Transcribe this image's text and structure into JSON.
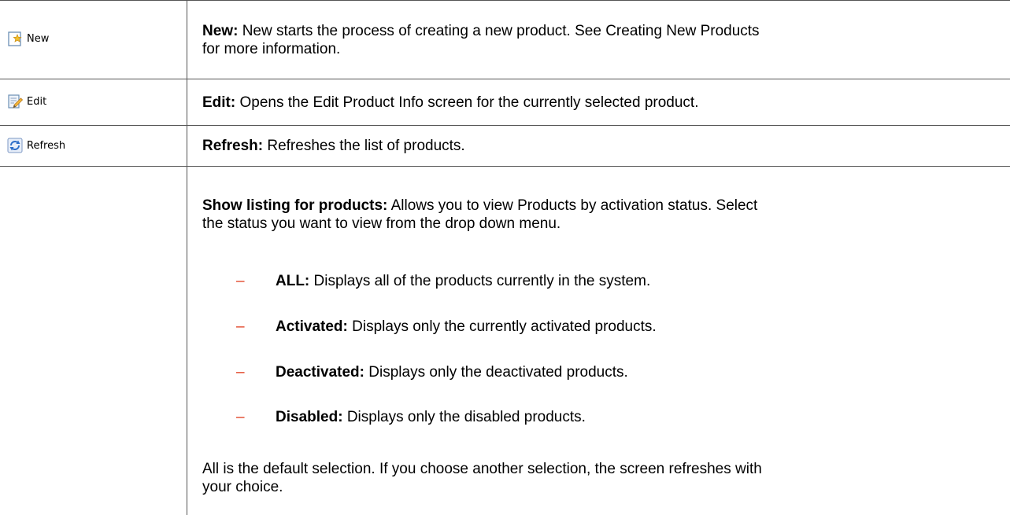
{
  "toolbar": {
    "new_label": "New",
    "edit_label": "Edit",
    "refresh_label": "Refresh"
  },
  "rows": {
    "new": {
      "term": "New:",
      "text": "New starts the process of creating a new product. See Creating New Products",
      "text2": "for more information."
    },
    "edit": {
      "term": "Edit:",
      "text": "Opens the Edit Product Info screen for the currently selected product."
    },
    "refresh": {
      "term": "Refresh:",
      "text": "Refreshes the list of products."
    },
    "listing": {
      "term": "Show listing for products:",
      "text": "Allows you to view Products by activation status. Select",
      "text2": "the status you want to view from the drop down menu.",
      "options": [
        {
          "term": "ALL:",
          "text": "Displays all of the products currently in the system."
        },
        {
          "term": "Activated:",
          "text": "Displays only the currently activated products."
        },
        {
          "term": "Deactivated:",
          "text": "Displays only the deactivated products."
        },
        {
          "term": "Disabled:",
          "text": "Displays only the disabled products."
        }
      ],
      "footer1": "All is the default selection. If you choose another selection, the screen refreshes with",
      "footer2": "your choice."
    }
  },
  "colors": {
    "dash": "#e03c1e",
    "border": "#555555"
  },
  "icons": {
    "new": "new-document-icon",
    "edit": "edit-pencil-icon",
    "refresh": "refresh-arrows-icon"
  }
}
